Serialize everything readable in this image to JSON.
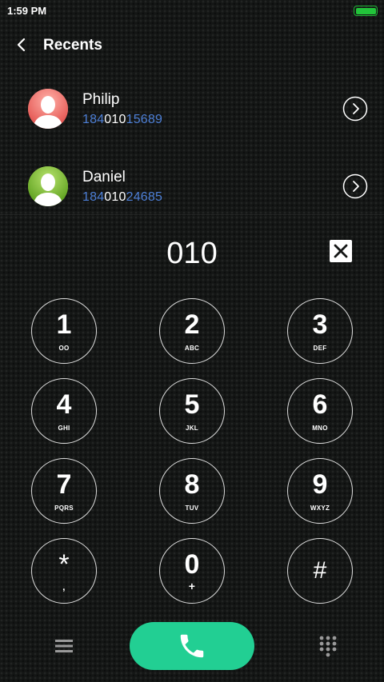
{
  "status_bar": {
    "time": "1:59 PM",
    "battery_color": "#22c43a"
  },
  "header": {
    "title": "Recents",
    "back_icon": "chevron-left-icon"
  },
  "recents": [
    {
      "name": "Philip",
      "number_prefix": "184",
      "number_match": "010",
      "number_suffix": "15689",
      "avatar_color": "#f07a78"
    },
    {
      "name": "Daniel",
      "number_prefix": "184",
      "number_match": "010",
      "number_suffix": "24685",
      "avatar_color": "#7fbf32"
    }
  ],
  "dialer": {
    "entered": "010",
    "clear_icon": "close-icon",
    "keys": [
      {
        "digit": "1",
        "letters": "OO"
      },
      {
        "digit": "2",
        "letters": "ABC"
      },
      {
        "digit": "3",
        "letters": "DEF"
      },
      {
        "digit": "4",
        "letters": "GHI"
      },
      {
        "digit": "5",
        "letters": "JKL"
      },
      {
        "digit": "6",
        "letters": "MNO"
      },
      {
        "digit": "7",
        "letters": "PQRS"
      },
      {
        "digit": "8",
        "letters": "TUV"
      },
      {
        "digit": "9",
        "letters": "WXYZ"
      },
      {
        "digit": "*",
        "letters": ","
      },
      {
        "digit": "0",
        "letters": "+"
      },
      {
        "digit": "#",
        "letters": ""
      }
    ]
  },
  "bottom_bar": {
    "menu_icon": "menu-icon",
    "call_icon": "phone-icon",
    "call_color": "#22cf93",
    "keypad_icon": "dialpad-icon"
  },
  "colors": {
    "number_blue": "#4d7fd6",
    "background": "#141615"
  }
}
